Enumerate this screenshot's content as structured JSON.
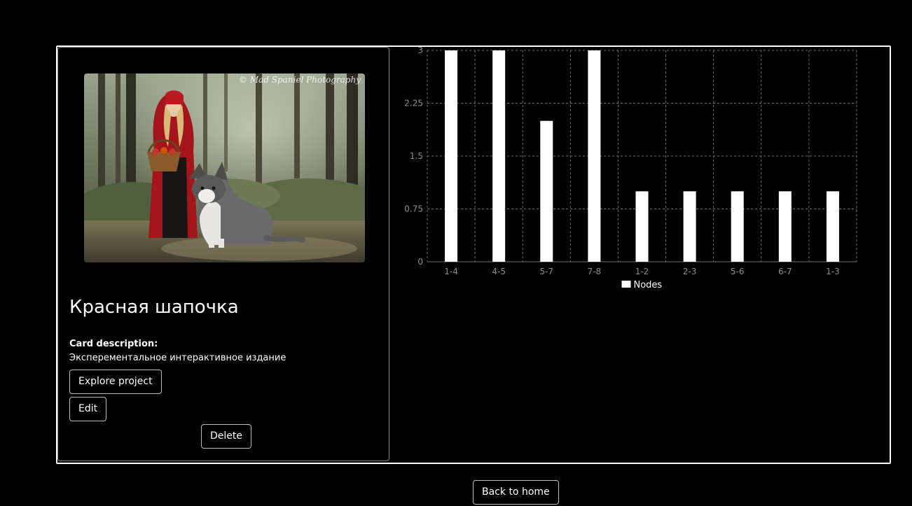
{
  "card": {
    "image": {
      "subject": "girl in red hooded cloak with basket beside husky in forest",
      "watermark": "© Mad Spaniel Photography"
    },
    "title": "Красная шапочка",
    "description_label": "Card description:",
    "description_text": "Эксперементальное интерактивное издание",
    "explore_label": "Explore project",
    "edit_label": "Edit",
    "delete_label": "Delete"
  },
  "footer": {
    "back_label": "Back to home"
  },
  "colors": {
    "background": "#000000",
    "foreground": "#ffffff",
    "grid": "#6e6e6e",
    "tick_text": "#8c8c8c",
    "border": "#bdbdbd"
  },
  "chart_data": {
    "type": "bar",
    "categories": [
      "1-4",
      "4-5",
      "5-7",
      "7-8",
      "1-2",
      "2-3",
      "5-6",
      "6-7",
      "1-3"
    ],
    "series": [
      {
        "name": "Nodes",
        "values": [
          3,
          3,
          2,
          3,
          1,
          1,
          1,
          1,
          1
        ],
        "color": "#ffffff"
      }
    ],
    "yticks": [
      "0",
      "0.75",
      "1.5",
      "2.25",
      "3"
    ],
    "ylim": [
      0,
      3
    ],
    "grid": true,
    "grid_style": "dashed",
    "legend_position": "bottom"
  }
}
